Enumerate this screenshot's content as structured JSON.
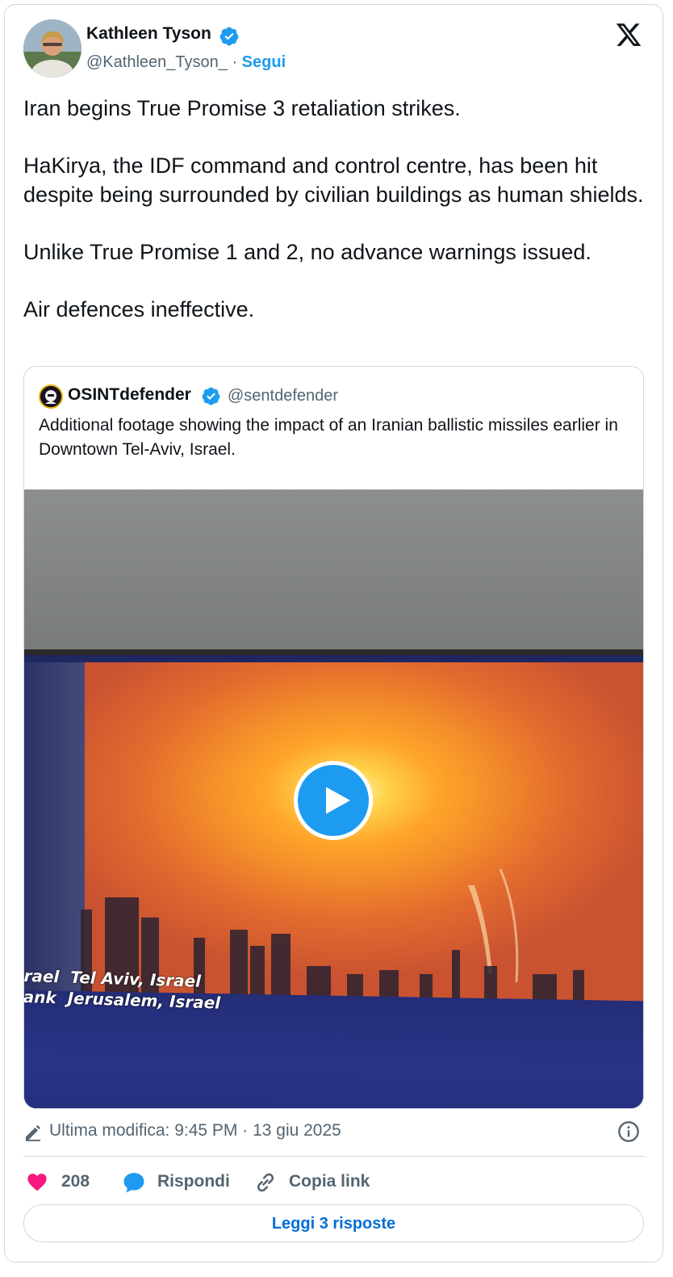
{
  "author": {
    "name": "Kathleen Tyson",
    "handle": "@Kathleen_Tyson_",
    "separator": "·",
    "follow_label": "Segui"
  },
  "tweet": {
    "paragraphs": [
      "Iran begins True Promise 3 retaliation strikes.",
      "HaKirya, the IDF command and control centre, has been hit despite being surrounded by civilian buildings as human shields.",
      "Unlike True Promise 1 and 2, no advance warnings issued.",
      "Air defences ineffective."
    ]
  },
  "quote": {
    "name": "OSINTdefender",
    "handle": "@sentdefender",
    "text": "Additional footage showing the impact of an Iranian ballistic missiles earlier in Downtown Tel-Aviv, Israel.",
    "video": {
      "ticker_line1": "rael  Tel Aviv, Israel",
      "ticker_line2": "ank  Jerusalem, Israel"
    }
  },
  "meta": {
    "edited_text": "Ultima modifica: 9:45 PM · 13 giu 2025"
  },
  "actions": {
    "likes": "208",
    "reply_label": "Rispondi",
    "copy_label": "Copia link"
  },
  "read_replies_label": "Leggi 3 risposte",
  "colors": {
    "accent": "#1d9bf0",
    "like": "#f91880",
    "link": "#006fd6",
    "muted": "#536471",
    "border": "#cfd9de"
  },
  "icons": [
    "verified-badge-icon",
    "x-logo-icon",
    "play-icon",
    "pencil-icon",
    "info-icon",
    "heart-icon",
    "reply-bubble-icon",
    "link-icon"
  ]
}
